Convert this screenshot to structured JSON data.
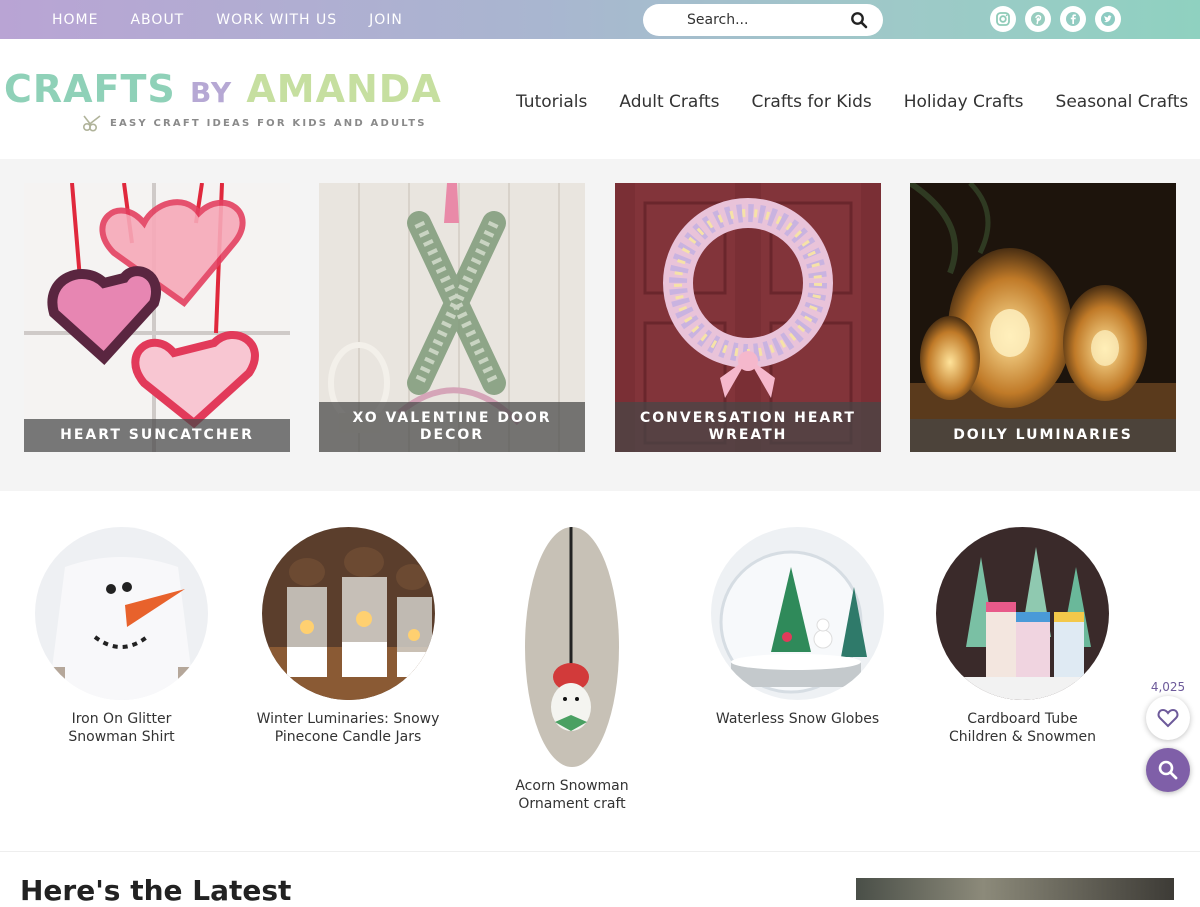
{
  "topnav": {
    "items": [
      {
        "label": "HOME"
      },
      {
        "label": "ABOUT"
      },
      {
        "label": "WORK WITH US"
      },
      {
        "label": "JOIN"
      }
    ]
  },
  "search": {
    "placeholder": "Search..."
  },
  "social": {
    "icons": [
      "instagram-icon",
      "pinterest-icon",
      "facebook-icon",
      "twitter-icon"
    ],
    "colors": {
      "instagram": "#c6dfa0",
      "pinterest": "#b6d9b8",
      "facebook": "#a9d6c4",
      "twitter": "#9ccfc0"
    }
  },
  "logo": {
    "word1": "CRAFTS",
    "word2": "BY",
    "word3": "AMANDA",
    "tagline": "EASY CRAFT IDEAS FOR KIDS AND ADULTS"
  },
  "mainnav": {
    "items": [
      {
        "label": "Tutorials"
      },
      {
        "label": "Adult Crafts"
      },
      {
        "label": "Crafts for Kids"
      },
      {
        "label": "Holiday Crafts"
      },
      {
        "label": "Seasonal Crafts"
      }
    ]
  },
  "featured": [
    {
      "title": "HEART SUNCATCHER"
    },
    {
      "title": "XO VALENTINE DOOR DECOR"
    },
    {
      "title": "CONVERSATION HEART WREATH"
    },
    {
      "title": "DOILY LUMINARIES"
    }
  ],
  "circles": [
    {
      "label": "Iron On Glitter Snowman Shirt"
    },
    {
      "label": "Winter Luminaries: Snowy Pinecone Candle Jars"
    },
    {
      "label": "Acorn Snowman Ornament craft"
    },
    {
      "label": "Waterless Snow Globes"
    },
    {
      "label": "Cardboard Tube Children & Snowmen"
    }
  ],
  "latest": {
    "heading": "Here's the Latest"
  },
  "fav": {
    "count": "4,025"
  },
  "colors": {
    "accent": "#7f5fa8",
    "topbar_start": "#b9a4d4",
    "topbar_end": "#8fd1c0"
  }
}
